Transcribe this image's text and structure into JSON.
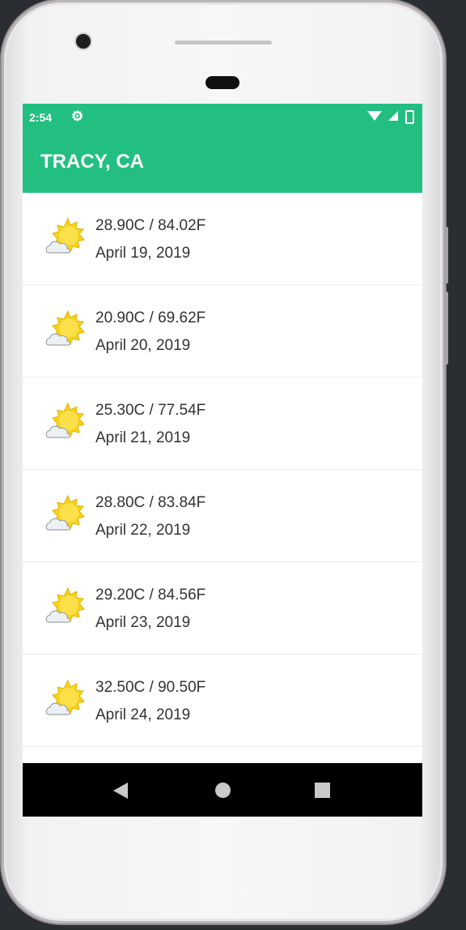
{
  "status_bar": {
    "time": "2:54",
    "icons": [
      "settings-icon",
      "wifi-icon",
      "signal-icon",
      "battery-icon"
    ]
  },
  "app_bar": {
    "title": "TRACY, CA",
    "color": "#22bf80"
  },
  "forecast": [
    {
      "temp": "28.90C / 84.02F",
      "date": "April 19, 2019",
      "icon": "partly-sunny-icon"
    },
    {
      "temp": "20.90C / 69.62F",
      "date": "April 20, 2019",
      "icon": "partly-sunny-icon"
    },
    {
      "temp": "25.30C / 77.54F",
      "date": "April 21, 2019",
      "icon": "partly-sunny-icon"
    },
    {
      "temp": "28.80C / 83.84F",
      "date": "April 22, 2019",
      "icon": "partly-sunny-icon"
    },
    {
      "temp": "29.20C / 84.56F",
      "date": "April 23, 2019",
      "icon": "partly-sunny-icon"
    },
    {
      "temp": "32.50C / 90.50F",
      "date": "April 24, 2019",
      "icon": "partly-sunny-icon"
    }
  ],
  "nav_bar": {
    "icons": [
      "back-icon",
      "home-icon",
      "recents-icon"
    ]
  }
}
